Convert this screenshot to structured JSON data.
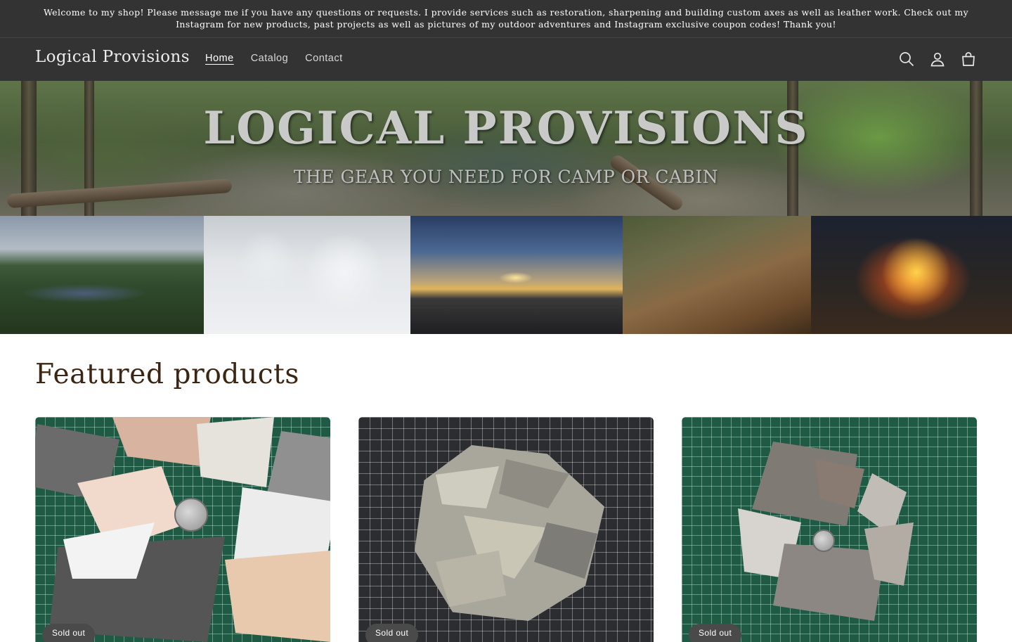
{
  "announcement": {
    "text": "Welcome to my shop! Please message me if you have any questions or requests. I provide services such as restoration, sharpening and building custom axes as well as leather work. Check out my Instagram for new products, past projects as well as pictures of my outdoor adventures and Instagram exclusive coupon codes! Thank you!"
  },
  "header": {
    "store_name": "Logical Provisions",
    "nav": [
      {
        "label": "Home",
        "active": true
      },
      {
        "label": "Catalog",
        "active": false
      },
      {
        "label": "Contact",
        "active": false
      }
    ],
    "icons": [
      "search-icon",
      "account-icon",
      "cart-icon"
    ]
  },
  "hero": {
    "title": "LOGICAL PROVISIONS",
    "tagline": "THE GEAR YOU NEED FOR CAMP OR CABIN"
  },
  "featured": {
    "heading": "Featured products",
    "products": [
      {
        "badge": "Sold out"
      },
      {
        "badge": "Sold out"
      },
      {
        "badge": "Sold out"
      }
    ]
  },
  "colors": {
    "header_bg": "#333333",
    "heading_text": "#3b2513",
    "badge_bg": "#4a4a4a"
  }
}
